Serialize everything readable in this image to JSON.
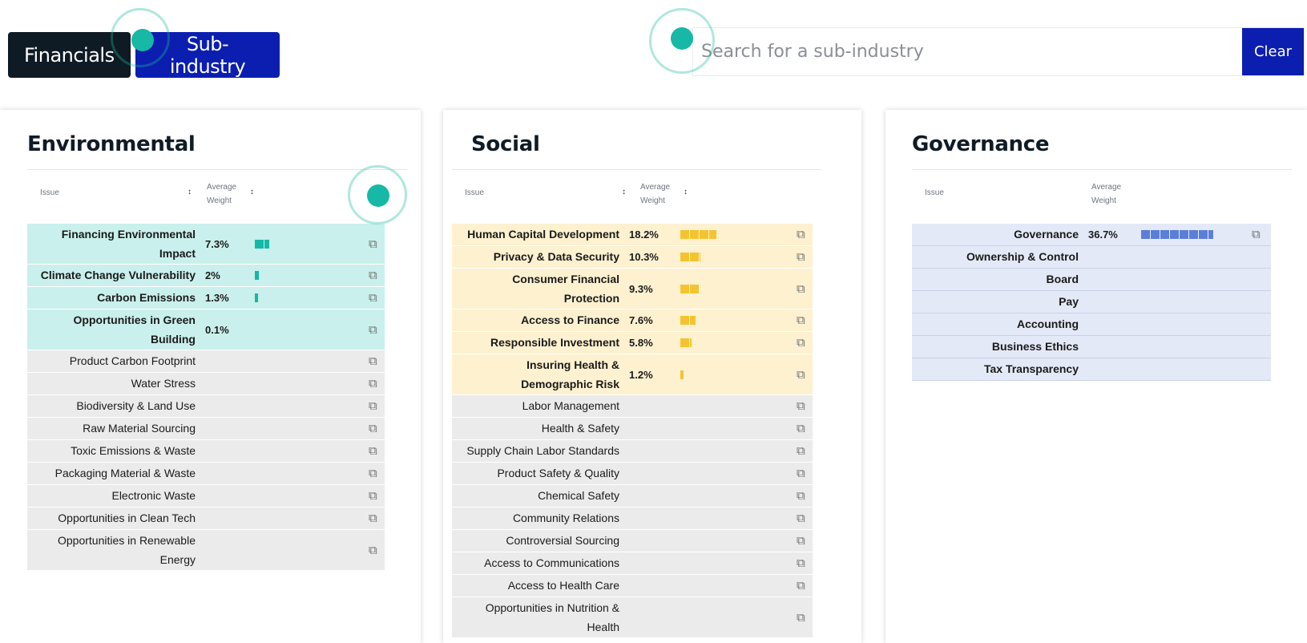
{
  "toggle": {
    "financials_label": "Financials",
    "subindustry_label": "Sub-industry"
  },
  "search": {
    "placeholder": "Search for a sub-industry",
    "clear_label": "Clear"
  },
  "colors": {
    "teal_highlight": "#c9f0ec",
    "teal_bar": "#14b8a6",
    "yellow_highlight": "#fdf1d0",
    "yellow_bar": "#f4c430",
    "blue_highlight": "#e3e9f7",
    "blue_bar": "#5b7fd8",
    "gray_row": "#ebebeb"
  },
  "columns": {
    "issue": "Issue",
    "avg_line1": "Average",
    "avg_line2": "Weight",
    "sort_icon": "↕"
  },
  "environmental": {
    "title": "Environmental",
    "weighted": [
      {
        "issue_lines": [
          "Financing Environmental",
          "Impact"
        ],
        "value": "7.3%",
        "bar_fraction": 0.2
      },
      {
        "issue_lines": [
          "Climate Change Vulnerability"
        ],
        "value": "2%",
        "bar_fraction": 0.05
      },
      {
        "issue_lines": [
          "Carbon Emissions"
        ],
        "value": "1.3%",
        "bar_fraction": 0.035
      },
      {
        "issue_lines": [
          "Opportunities in Green",
          "Building"
        ],
        "value": "0.1%",
        "bar_fraction": 0
      }
    ],
    "other": [
      [
        "Product Carbon Footprint"
      ],
      [
        "Water Stress"
      ],
      [
        "Biodiversity & Land Use"
      ],
      [
        "Raw Material Sourcing"
      ],
      [
        "Toxic Emissions & Waste"
      ],
      [
        "Packaging Material & Waste"
      ],
      [
        "Electronic Waste"
      ],
      [
        "Opportunities in Clean Tech"
      ],
      [
        "Opportunities in Renewable",
        "Energy"
      ]
    ]
  },
  "social": {
    "title": "Social",
    "weighted": [
      {
        "issue_lines": [
          "Human Capital Development"
        ],
        "value": "18.2%",
        "bar_fraction": 0.5
      },
      {
        "issue_lines": [
          "Privacy & Data Security"
        ],
        "value": "10.3%",
        "bar_fraction": 0.28
      },
      {
        "issue_lines": [
          "Consumer Financial",
          "Protection"
        ],
        "value": "9.3%",
        "bar_fraction": 0.25
      },
      {
        "issue_lines": [
          "Access to Finance"
        ],
        "value": "7.6%",
        "bar_fraction": 0.21
      },
      {
        "issue_lines": [
          "Responsible Investment"
        ],
        "value": "5.8%",
        "bar_fraction": 0.16
      },
      {
        "issue_lines": [
          "Insuring Health &",
          "Demographic Risk"
        ],
        "value": "1.2%",
        "bar_fraction": 0.033
      }
    ],
    "other": [
      [
        "Labor Management"
      ],
      [
        "Health & Safety"
      ],
      [
        "Supply Chain Labor Standards"
      ],
      [
        "Product Safety & Quality"
      ],
      [
        "Chemical Safety"
      ],
      [
        "Community Relations"
      ],
      [
        "Controversial Sourcing"
      ],
      [
        "Access to Communications"
      ],
      [
        "Access to Health Care"
      ],
      [
        "Opportunities in Nutrition &",
        "Health"
      ]
    ]
  },
  "governance": {
    "title": "Governance",
    "weighted": [
      {
        "issue_lines": [
          "Governance"
        ],
        "value": "36.7%",
        "bar_fraction": 1.0
      }
    ],
    "sub": [
      [
        "Ownership & Control"
      ],
      [
        "Board"
      ],
      [
        "Pay"
      ],
      [
        "Accounting"
      ],
      [
        "Business Ethics"
      ],
      [
        "Tax Transparency"
      ]
    ]
  },
  "icons": {
    "external_link": "⧉"
  }
}
